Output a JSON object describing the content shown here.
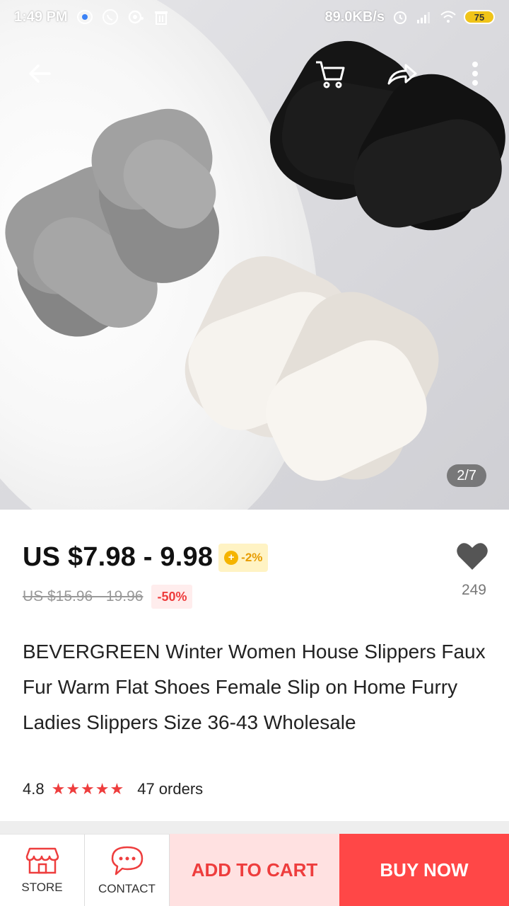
{
  "status_bar": {
    "time": "1:49 PM",
    "network_speed": "89.0KB/s",
    "battery": "75"
  },
  "gallery": {
    "indicator": "2/7"
  },
  "product": {
    "price": "US $7.98 - 9.98",
    "coin_discount": "-2%",
    "original_price": "US $15.96 - 19.96",
    "discount": "-50%",
    "wishlist_count": "249",
    "title": "BEVERGREEN Winter Women House Slippers Faux Fur Warm Flat Shoes Female Slip on Home Furry Ladies Slippers Size 36-43 Wholesale",
    "rating": "4.8",
    "stars": "★★★★★",
    "orders": "47 orders"
  },
  "bottom_bar": {
    "store_label": "STORE",
    "contact_label": "CONTACT",
    "add_to_cart_label": "ADD TO CART",
    "buy_now_label": "BUY NOW"
  },
  "colors": {
    "accent_red": "#ff4747",
    "add_cart_bg": "#ffe1e1",
    "star_red": "#ee3d3d",
    "coin_gold": "#f5b400"
  }
}
